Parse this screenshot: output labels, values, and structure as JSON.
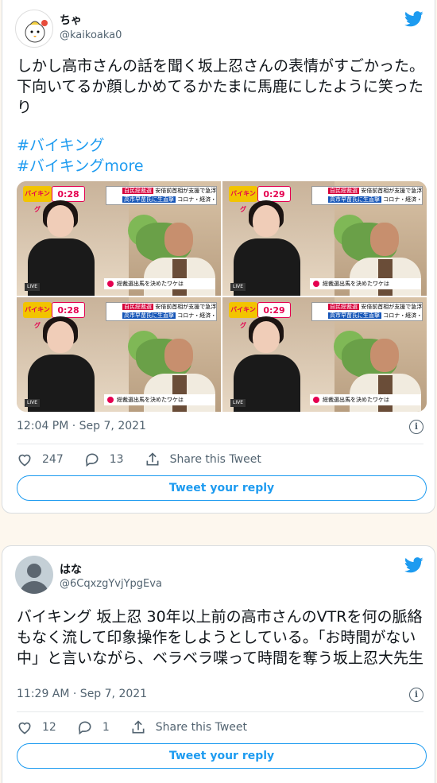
{
  "tweets": [
    {
      "name": "ちゃ",
      "handle": "@kaikoaka0",
      "text": "しかし高市さんの話を聞く坂上忍さんの表情がすごかった。下向いてるか顔しかめてるかたまに馬鹿にしたように笑ったり",
      "hashtags": [
        "#バイキング",
        "#バイキングmore"
      ],
      "time": "12:04 PM · Sep 7, 2021",
      "likes": "247",
      "replies": "13",
      "share_label": "Share this Tweet",
      "reply_button": "Tweet your reply",
      "media": {
        "frames": [
          {
            "clock": "0:28"
          },
          {
            "clock": "0:29"
          },
          {
            "clock": "0:28"
          },
          {
            "clock": "0:29"
          }
        ],
        "logo_text": "バイキング",
        "topbar_red": "自民総裁選",
        "topbar_text": "安倍前首相が支援で急浮上",
        "topbar_blue": "高市早苗氏に生直撃",
        "topbar_tail": "コロナ・経済・女性総裁",
        "caption": "総裁選出馬を決めたワケは",
        "live": "LIVE"
      }
    },
    {
      "name": "はな",
      "handle": "@6CqxzgYvjYpgEva",
      "text": "バイキング 坂上忍 30年以上前の高市さんのVTRを何の脈絡もなく流して印象操作をしようとしている。「お時間がない中」と言いながら、ベラベラ喋って時間を奪う坂上忍大先生",
      "time": "11:29 AM · Sep 7, 2021",
      "likes": "12",
      "replies": "1",
      "share_label": "Share this Tweet",
      "reply_button": "Tweet your reply"
    }
  ],
  "colors": {
    "accent": "#1d9bf0",
    "background": "#fdf7ee",
    "muted": "#536471"
  }
}
